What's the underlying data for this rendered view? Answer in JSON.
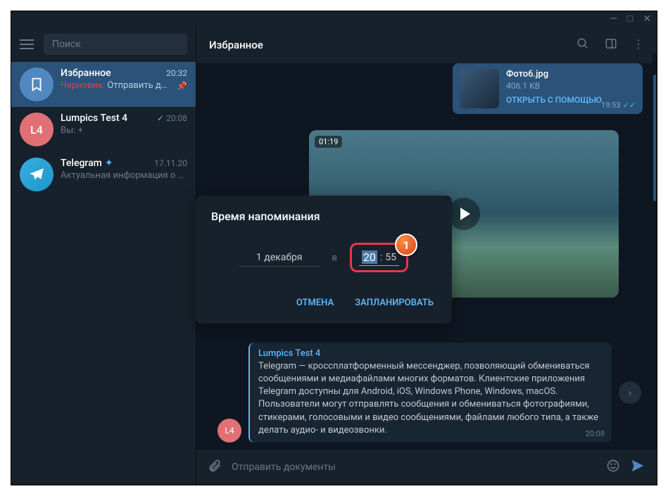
{
  "titlebar": {
    "min": "—",
    "max": "□",
    "close": "✕"
  },
  "search": {
    "placeholder": "Поиск"
  },
  "chats": [
    {
      "name": "Избранное",
      "time": "20:32",
      "draft_label": "Черновик:",
      "preview": " Отправить д…",
      "avatar": "saved"
    },
    {
      "name": "Lumpics Test 4",
      "time": "20:08",
      "preview": "Вы: +",
      "avatar": "L4",
      "read": true
    },
    {
      "name": "Telegram",
      "time": "17.11.20",
      "preview": "Актуальная информация о …",
      "avatar": "tg",
      "verified": true
    }
  ],
  "header": {
    "title": "Избранное"
  },
  "file": {
    "name": "Фото6.jpg",
    "size": "406.1 KB",
    "action": "ОТКРЫТЬ С ПОМОЩЬЮ",
    "time": "19:53"
  },
  "video": {
    "duration": "01:19"
  },
  "fwd": {
    "from": "Lumpics Test 4",
    "text": "Telegram — кроссплатформенный мессенджер, позволяющий обмениваться сообщениями и медиафайлами многих форматов. Клиентские приложения Telegram доступны для Android, iOS, Windows Phone, Windows, macOS. Пользователи могут отправлять сообщения и обмениваться фотографиями, стикерами, голосовыми и видео сообщениями, файлами любого типа, а также делать аудио- и видеозвонки.",
    "avatar": "L4",
    "time": "20:08"
  },
  "input": {
    "placeholder": "Отправить документы"
  },
  "modal": {
    "title": "Время напоминания",
    "date": "1 декабря",
    "at": "в",
    "hour": "20",
    "minute": "55",
    "cancel": "ОТМЕНА",
    "schedule": "ЗАПЛАНИРОВАТЬ",
    "badge": "1"
  }
}
